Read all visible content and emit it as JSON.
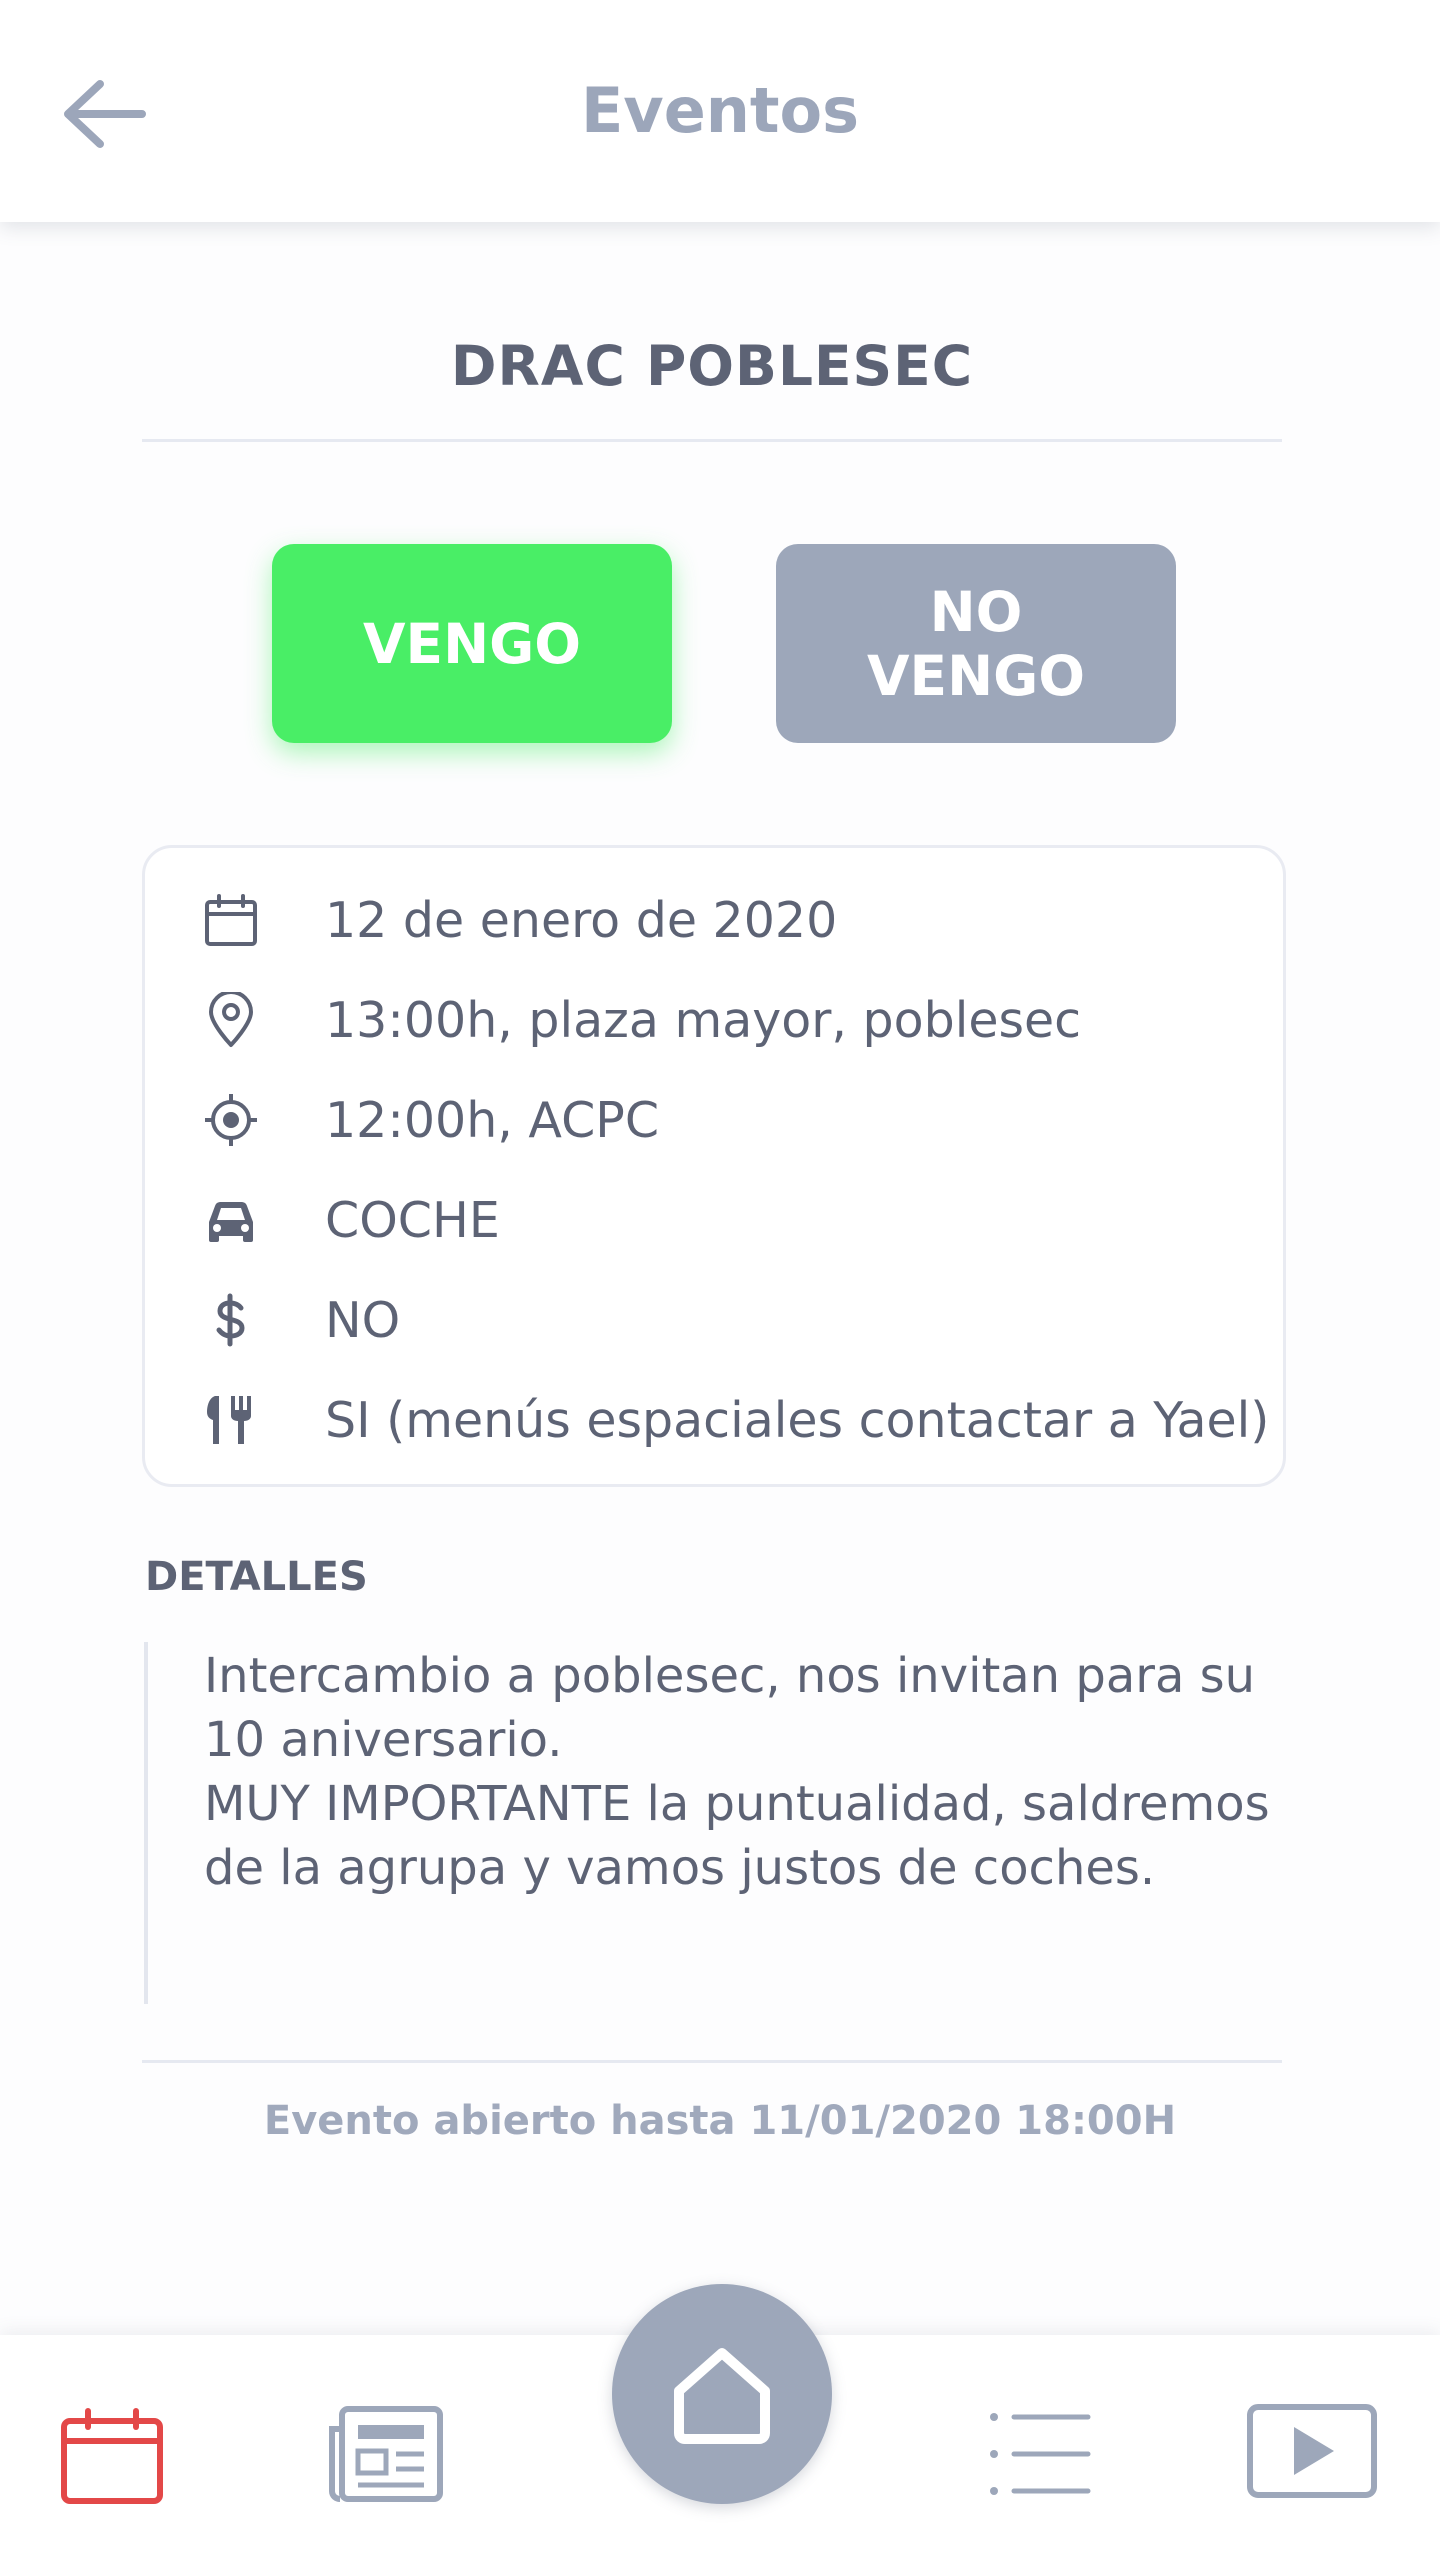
{
  "header": {
    "title": "Eventos",
    "back_icon": "arrow-left-icon"
  },
  "event": {
    "title": "DRAC POBLESEC"
  },
  "rsvp": {
    "yes_label": "VENGO",
    "no_label": "NO\nVENGO",
    "yes_color": "#49ee66",
    "no_color": "#9da7ba"
  },
  "info": [
    {
      "icon": "calendar-icon",
      "text": "12 de enero de 2020"
    },
    {
      "icon": "map-pin-icon",
      "text": "13:00h, plaza mayor, poblesec"
    },
    {
      "icon": "crosshair-icon",
      "text": "12:00h, ACPC"
    },
    {
      "icon": "car-icon",
      "text": "COCHE"
    },
    {
      "icon": "dollar-icon",
      "text": "NO"
    },
    {
      "icon": "utensils-icon",
      "text": "SI (menús espaciales contactar a Yael)"
    }
  ],
  "details": {
    "label": "DETALLES",
    "text": "Intercambio a poblesec, nos invitan para su 10 aniversario.\nMUY IMPORTANTE la puntualidad, saldremos de la agrupa y vamos justos de coches."
  },
  "footer_note": "Evento abierto hasta 11/01/2020 18:00H",
  "nav": {
    "items": [
      "calendar-icon",
      "newspaper-icon",
      "home-icon",
      "list-icon",
      "video-play-icon"
    ],
    "active": "calendar-icon",
    "active_color": "#e34848",
    "inactive_color": "#9da7ba"
  }
}
